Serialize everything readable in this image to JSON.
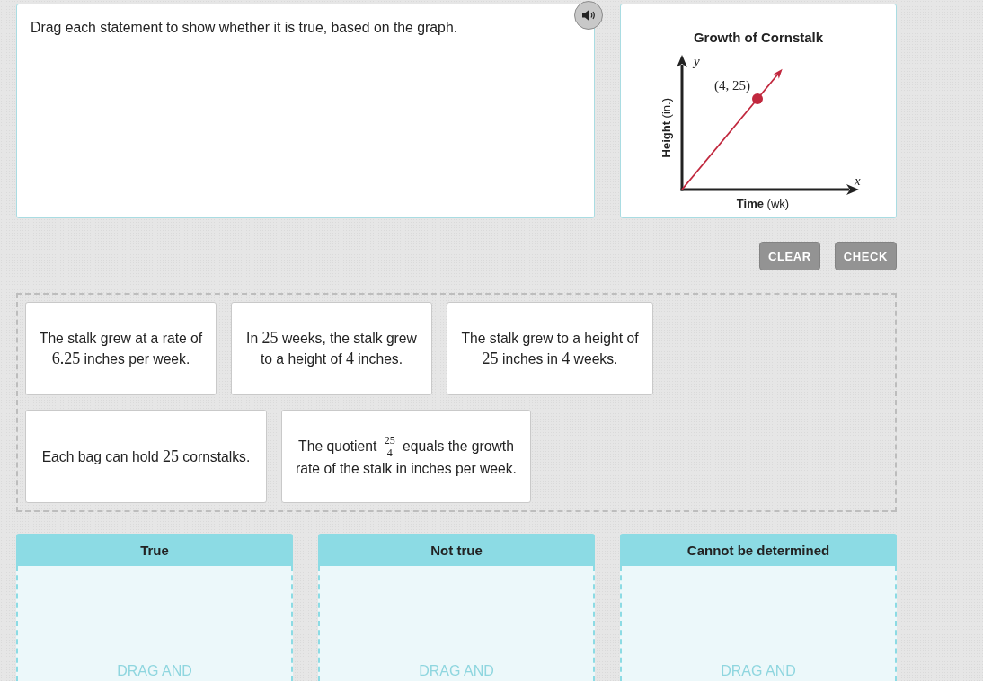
{
  "question": {
    "prompt": "Drag each statement to show whether it is true, based on the graph."
  },
  "graph": {
    "title": "Growth of Cornstalk",
    "y_label": "**Height** (in.)",
    "x_label": "**Time** (wk)",
    "y_symbol": "y",
    "x_symbol": "x",
    "point_label": "(4, 25)"
  },
  "buttons": [
    {
      "label": "CLEAR",
      "disabled": true
    },
    {
      "label": "CHECK",
      "disabled": true
    }
  ],
  "statements": [
    {
      "parts": [
        {
          "kind": "text",
          "text": "The stalk grew at a rate of "
        },
        {
          "kind": "math",
          "text": "6.25"
        },
        {
          "kind": "text",
          "text": " inches per week."
        }
      ]
    },
    {
      "parts": [
        {
          "kind": "text",
          "text": "In "
        },
        {
          "kind": "math",
          "text": "25"
        },
        {
          "kind": "text",
          "text": " weeks, the stalk grew to a height of "
        },
        {
          "kind": "math",
          "text": "4"
        },
        {
          "kind": "text",
          "text": " inches."
        }
      ]
    },
    {
      "parts": [
        {
          "kind": "text",
          "text": "The stalk grew to a height of "
        },
        {
          "kind": "math",
          "text": "25"
        },
        {
          "kind": "text",
          "text": " inches in "
        },
        {
          "kind": "math",
          "text": "4"
        },
        {
          "kind": "text",
          "text": " weeks."
        }
      ]
    },
    {
      "parts": [
        {
          "kind": "text",
          "text": "Each bag can hold "
        },
        {
          "kind": "math",
          "text": "25"
        },
        {
          "kind": "text",
          "text": " cornstalks."
        }
      ]
    },
    {
      "parts": [
        {
          "kind": "text",
          "text": "The quotient "
        },
        {
          "kind": "fraction",
          "numerator": "25",
          "denominator": "4"
        },
        {
          "kind": "text",
          "text": " equals the growth rate of the stalk in inches per week."
        }
      ]
    }
  ],
  "categories": [
    {
      "title": "True",
      "hint": "DRAG AND"
    },
    {
      "title": "Not true",
      "hint": "DRAG AND"
    },
    {
      "title": "Cannot be determined",
      "hint": "DRAG AND"
    }
  ]
}
